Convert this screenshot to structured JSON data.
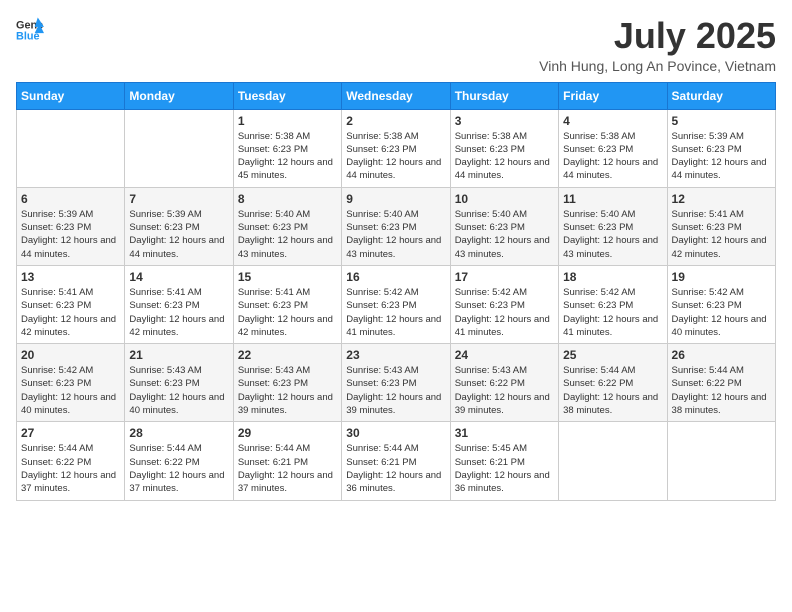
{
  "header": {
    "logo": {
      "general": "General",
      "blue": "Blue"
    },
    "title": "July 2025",
    "location": "Vinh Hung, Long An Povince, Vietnam"
  },
  "weekdays": [
    "Sunday",
    "Monday",
    "Tuesday",
    "Wednesday",
    "Thursday",
    "Friday",
    "Saturday"
  ],
  "weeks": [
    [
      {
        "day": "",
        "sunrise": "",
        "sunset": "",
        "daylight": ""
      },
      {
        "day": "",
        "sunrise": "",
        "sunset": "",
        "daylight": ""
      },
      {
        "day": "1",
        "sunrise": "Sunrise: 5:38 AM",
        "sunset": "Sunset: 6:23 PM",
        "daylight": "Daylight: 12 hours and 45 minutes."
      },
      {
        "day": "2",
        "sunrise": "Sunrise: 5:38 AM",
        "sunset": "Sunset: 6:23 PM",
        "daylight": "Daylight: 12 hours and 44 minutes."
      },
      {
        "day": "3",
        "sunrise": "Sunrise: 5:38 AM",
        "sunset": "Sunset: 6:23 PM",
        "daylight": "Daylight: 12 hours and 44 minutes."
      },
      {
        "day": "4",
        "sunrise": "Sunrise: 5:38 AM",
        "sunset": "Sunset: 6:23 PM",
        "daylight": "Daylight: 12 hours and 44 minutes."
      },
      {
        "day": "5",
        "sunrise": "Sunrise: 5:39 AM",
        "sunset": "Sunset: 6:23 PM",
        "daylight": "Daylight: 12 hours and 44 minutes."
      }
    ],
    [
      {
        "day": "6",
        "sunrise": "Sunrise: 5:39 AM",
        "sunset": "Sunset: 6:23 PM",
        "daylight": "Daylight: 12 hours and 44 minutes."
      },
      {
        "day": "7",
        "sunrise": "Sunrise: 5:39 AM",
        "sunset": "Sunset: 6:23 PM",
        "daylight": "Daylight: 12 hours and 44 minutes."
      },
      {
        "day": "8",
        "sunrise": "Sunrise: 5:40 AM",
        "sunset": "Sunset: 6:23 PM",
        "daylight": "Daylight: 12 hours and 43 minutes."
      },
      {
        "day": "9",
        "sunrise": "Sunrise: 5:40 AM",
        "sunset": "Sunset: 6:23 PM",
        "daylight": "Daylight: 12 hours and 43 minutes."
      },
      {
        "day": "10",
        "sunrise": "Sunrise: 5:40 AM",
        "sunset": "Sunset: 6:23 PM",
        "daylight": "Daylight: 12 hours and 43 minutes."
      },
      {
        "day": "11",
        "sunrise": "Sunrise: 5:40 AM",
        "sunset": "Sunset: 6:23 PM",
        "daylight": "Daylight: 12 hours and 43 minutes."
      },
      {
        "day": "12",
        "sunrise": "Sunrise: 5:41 AM",
        "sunset": "Sunset: 6:23 PM",
        "daylight": "Daylight: 12 hours and 42 minutes."
      }
    ],
    [
      {
        "day": "13",
        "sunrise": "Sunrise: 5:41 AM",
        "sunset": "Sunset: 6:23 PM",
        "daylight": "Daylight: 12 hours and 42 minutes."
      },
      {
        "day": "14",
        "sunrise": "Sunrise: 5:41 AM",
        "sunset": "Sunset: 6:23 PM",
        "daylight": "Daylight: 12 hours and 42 minutes."
      },
      {
        "day": "15",
        "sunrise": "Sunrise: 5:41 AM",
        "sunset": "Sunset: 6:23 PM",
        "daylight": "Daylight: 12 hours and 42 minutes."
      },
      {
        "day": "16",
        "sunrise": "Sunrise: 5:42 AM",
        "sunset": "Sunset: 6:23 PM",
        "daylight": "Daylight: 12 hours and 41 minutes."
      },
      {
        "day": "17",
        "sunrise": "Sunrise: 5:42 AM",
        "sunset": "Sunset: 6:23 PM",
        "daylight": "Daylight: 12 hours and 41 minutes."
      },
      {
        "day": "18",
        "sunrise": "Sunrise: 5:42 AM",
        "sunset": "Sunset: 6:23 PM",
        "daylight": "Daylight: 12 hours and 41 minutes."
      },
      {
        "day": "19",
        "sunrise": "Sunrise: 5:42 AM",
        "sunset": "Sunset: 6:23 PM",
        "daylight": "Daylight: 12 hours and 40 minutes."
      }
    ],
    [
      {
        "day": "20",
        "sunrise": "Sunrise: 5:42 AM",
        "sunset": "Sunset: 6:23 PM",
        "daylight": "Daylight: 12 hours and 40 minutes."
      },
      {
        "day": "21",
        "sunrise": "Sunrise: 5:43 AM",
        "sunset": "Sunset: 6:23 PM",
        "daylight": "Daylight: 12 hours and 40 minutes."
      },
      {
        "day": "22",
        "sunrise": "Sunrise: 5:43 AM",
        "sunset": "Sunset: 6:23 PM",
        "daylight": "Daylight: 12 hours and 39 minutes."
      },
      {
        "day": "23",
        "sunrise": "Sunrise: 5:43 AM",
        "sunset": "Sunset: 6:23 PM",
        "daylight": "Daylight: 12 hours and 39 minutes."
      },
      {
        "day": "24",
        "sunrise": "Sunrise: 5:43 AM",
        "sunset": "Sunset: 6:22 PM",
        "daylight": "Daylight: 12 hours and 39 minutes."
      },
      {
        "day": "25",
        "sunrise": "Sunrise: 5:44 AM",
        "sunset": "Sunset: 6:22 PM",
        "daylight": "Daylight: 12 hours and 38 minutes."
      },
      {
        "day": "26",
        "sunrise": "Sunrise: 5:44 AM",
        "sunset": "Sunset: 6:22 PM",
        "daylight": "Daylight: 12 hours and 38 minutes."
      }
    ],
    [
      {
        "day": "27",
        "sunrise": "Sunrise: 5:44 AM",
        "sunset": "Sunset: 6:22 PM",
        "daylight": "Daylight: 12 hours and 37 minutes."
      },
      {
        "day": "28",
        "sunrise": "Sunrise: 5:44 AM",
        "sunset": "Sunset: 6:22 PM",
        "daylight": "Daylight: 12 hours and 37 minutes."
      },
      {
        "day": "29",
        "sunrise": "Sunrise: 5:44 AM",
        "sunset": "Sunset: 6:21 PM",
        "daylight": "Daylight: 12 hours and 37 minutes."
      },
      {
        "day": "30",
        "sunrise": "Sunrise: 5:44 AM",
        "sunset": "Sunset: 6:21 PM",
        "daylight": "Daylight: 12 hours and 36 minutes."
      },
      {
        "day": "31",
        "sunrise": "Sunrise: 5:45 AM",
        "sunset": "Sunset: 6:21 PM",
        "daylight": "Daylight: 12 hours and 36 minutes."
      },
      {
        "day": "",
        "sunrise": "",
        "sunset": "",
        "daylight": ""
      },
      {
        "day": "",
        "sunrise": "",
        "sunset": "",
        "daylight": ""
      }
    ]
  ]
}
